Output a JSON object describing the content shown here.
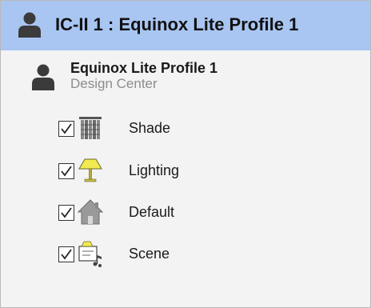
{
  "header": {
    "title": "IC-II 1 : Equinox Lite Profile 1",
    "icon": "person-icon"
  },
  "profile": {
    "name": "Equinox Lite Profile 1",
    "subtitle": "Design Center",
    "icon": "person-icon"
  },
  "items": [
    {
      "label": "Shade",
      "checked": true,
      "icon": "shade-icon"
    },
    {
      "label": "Lighting",
      "checked": true,
      "icon": "lamp-icon"
    },
    {
      "label": "Default",
      "checked": true,
      "icon": "house-icon"
    },
    {
      "label": "Scene",
      "checked": true,
      "icon": "scene-icon"
    }
  ],
  "colors": {
    "header_bg": "#a9c6f2",
    "panel_bg": "#f3f3f3",
    "lamp_yellow": "#f2ea52",
    "subtitle_gray": "#8c8c8c"
  }
}
